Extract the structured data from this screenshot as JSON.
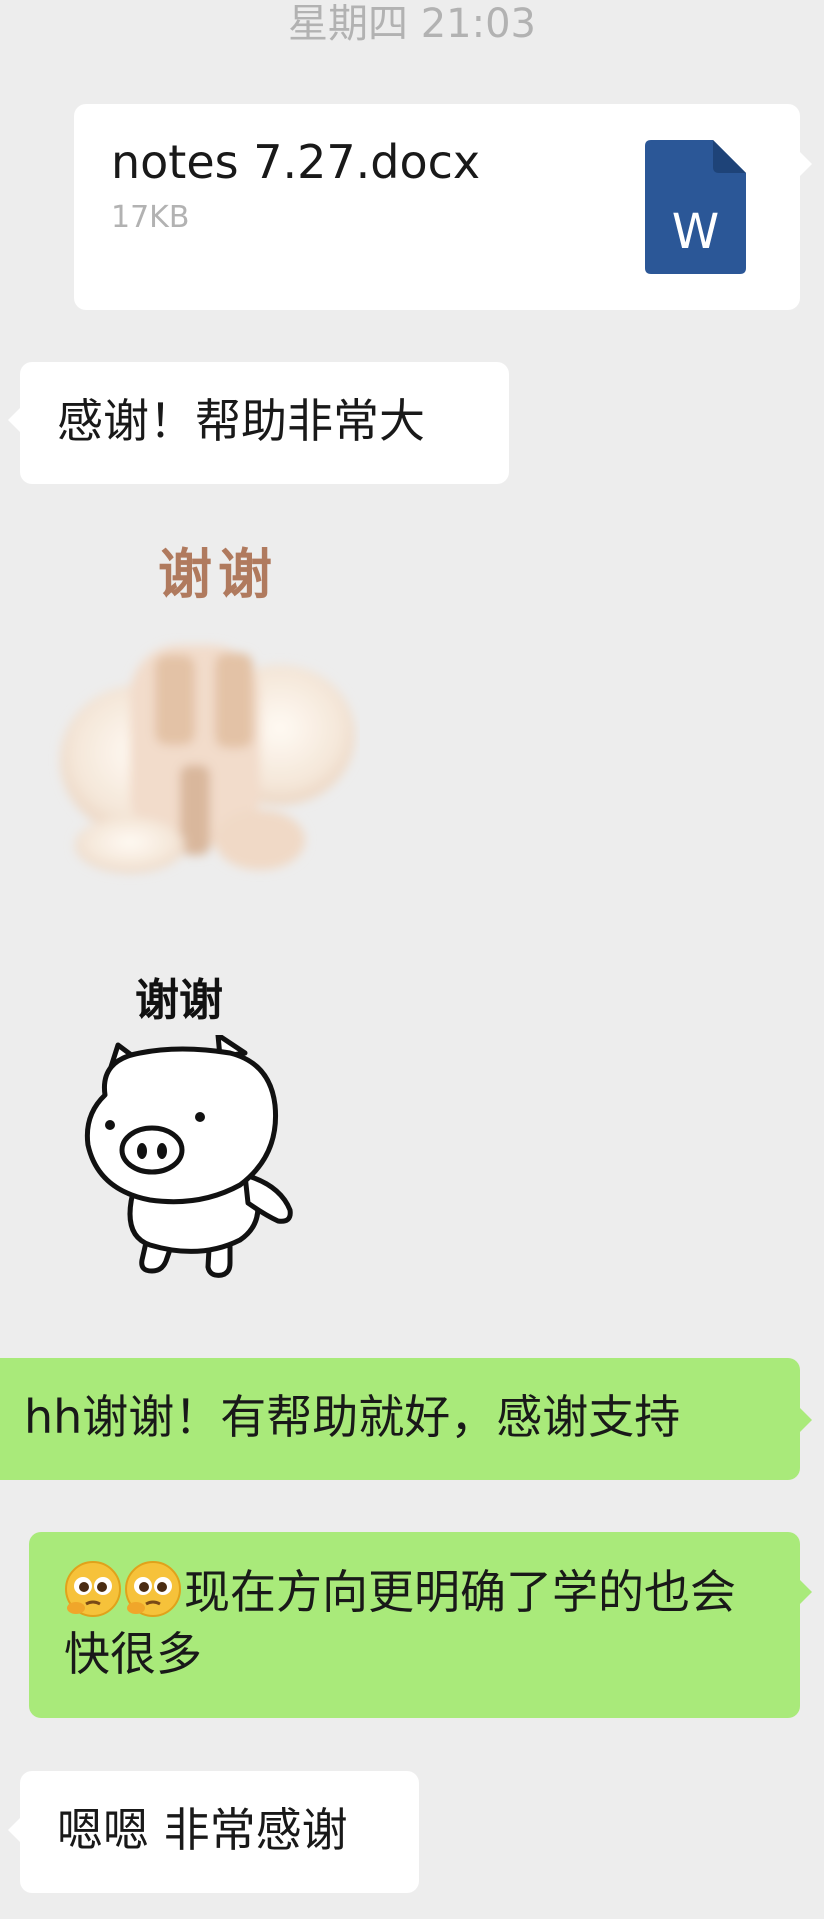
{
  "timestamp": "星期四 21:03",
  "colors": {
    "background": "#ededed",
    "incoming_bubble": "#ffffff",
    "outgoing_bubble": "#a9ea7a",
    "word_icon": "#2b5797"
  },
  "messages": {
    "file": {
      "name": "notes 7.27.docx",
      "size": "17KB",
      "icon": "word-document-icon",
      "icon_letter": "W"
    },
    "thanks_big_help": "感谢！帮助非常大",
    "sticker_hamster": {
      "label": "谢谢",
      "icon": "hamster-sticker"
    },
    "sticker_pig": {
      "label": "谢谢",
      "icon": "pig-sticker"
    },
    "reply_1": "hh谢谢！有帮助就好，感谢支持",
    "reply_2": {
      "emoji": "pleading-face-emoji",
      "text": "现在方向更明确了学的也会快很多"
    },
    "last_incoming": "嗯嗯 非常感谢"
  }
}
